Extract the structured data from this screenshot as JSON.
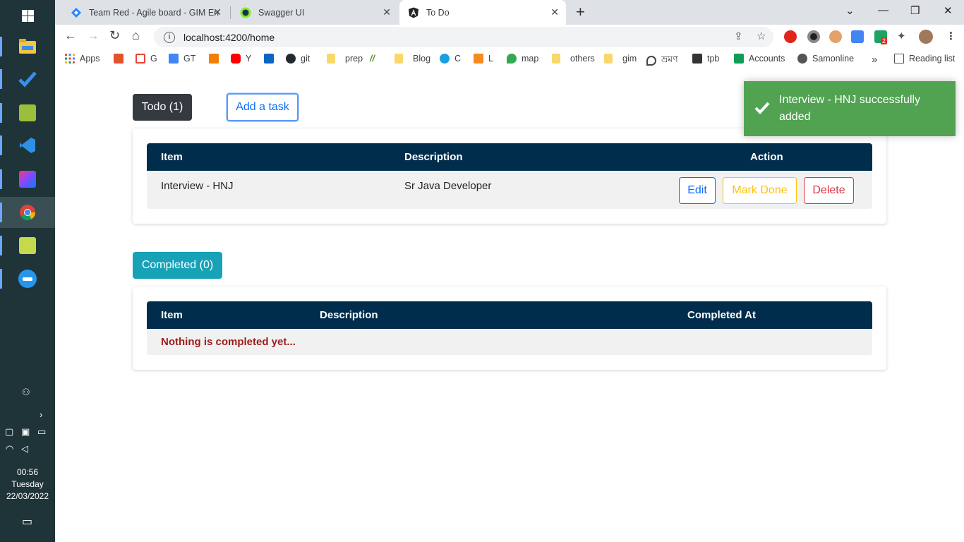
{
  "browser": {
    "tabs": [
      {
        "title": "Team Red - Agile board - GIM En",
        "active": false
      },
      {
        "title": "Swagger UI",
        "active": false
      },
      {
        "title": "To Do",
        "active": true
      }
    ],
    "address": "localhost:4200/home",
    "bookmarks": [
      "Apps",
      "G",
      "GT",
      "Y",
      "git",
      "prep",
      "Blog",
      "C",
      "L",
      "map",
      "others",
      "gim",
      "ভ্রমণ",
      "tpb",
      "Accounts",
      "Samonline"
    ],
    "more_label": "»",
    "reading_list": "Reading list",
    "ext_badge": "2"
  },
  "taskbar": {
    "time": "00:56",
    "day": "Tuesday",
    "date": "22/03/2022"
  },
  "todo": {
    "header_label": "Todo (1)",
    "add_task_label": "Add a task",
    "columns": [
      "Item",
      "Description",
      "Action"
    ],
    "rows": [
      {
        "item": "Interview - HNJ",
        "description": "Sr Java Developer"
      }
    ],
    "actions": {
      "edit": "Edit",
      "mark_done": "Mark Done",
      "delete": "Delete"
    }
  },
  "completed": {
    "header_label": "Completed (0)",
    "columns": [
      "Item",
      "Description",
      "Completed At"
    ],
    "empty_message": "Nothing is completed yet..."
  },
  "toast": {
    "message": "Interview - HNJ successfully added"
  },
  "colors": {
    "table_header": "#002d4c",
    "toast_success": "#51a351",
    "todo_badge": "#343a40",
    "completed_badge": "#17a2b8"
  }
}
